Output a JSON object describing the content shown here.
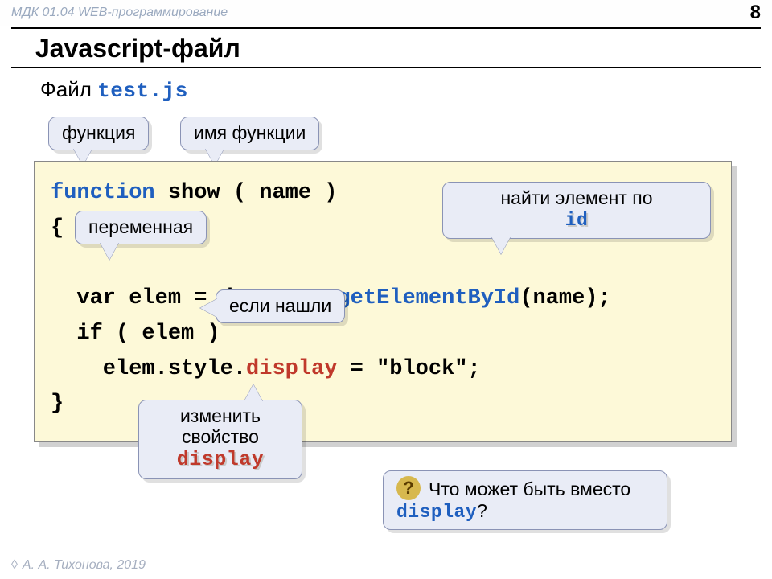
{
  "header": {
    "course": "МДК 01.04 WEB-программирование",
    "page_number": "8"
  },
  "title": "Javascript-файл",
  "subtitle_prefix": "Файл ",
  "subtitle_filename": "test.js",
  "callouts": {
    "function": "функция",
    "func_name": "имя функции",
    "variable": "переменная",
    "find_prefix": "найти элемент по",
    "find_code": "id",
    "if_found": "если нашли",
    "change1": "изменить",
    "change2": "свойство",
    "change_code": "display",
    "question_prefix": "Что может быть вместо ",
    "question_code": "display",
    "question_suffix": "?"
  },
  "code": {
    "l1a": "function",
    "l1b": " show ( name )",
    "l2": "{",
    "l3a": "  var elem = document.",
    "l3b": "getElementById",
    "l3c": "(name);",
    "l4": "  if ( elem )",
    "l5a": "    elem.style.",
    "l5b": "display",
    "l5c": " = \"block\";",
    "l6": "}"
  },
  "footer": "А. А. Тихонова, 2019"
}
